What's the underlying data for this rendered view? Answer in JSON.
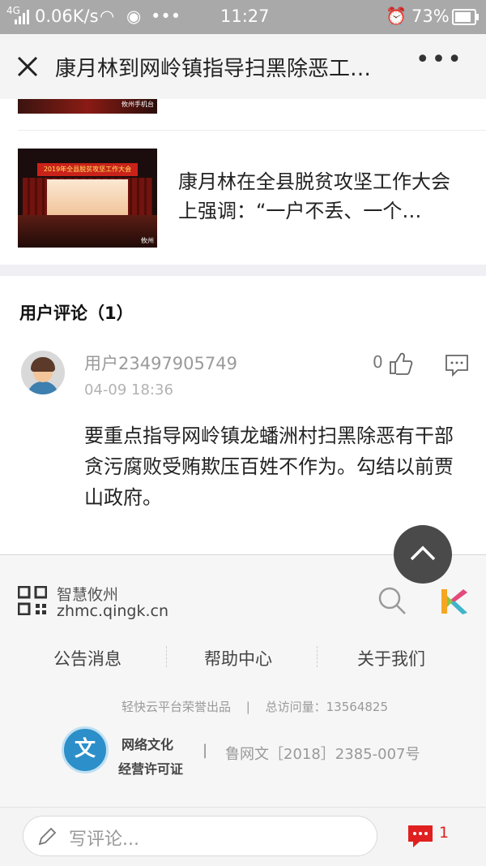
{
  "status": {
    "network": "4G",
    "speed": "0.06K/s",
    "time": "11:27",
    "battery": "73%"
  },
  "header": {
    "title": "康月林到网岭镇指导扫黑除恶工…",
    "more": "•••"
  },
  "related": [
    {
      "image_tag": "攸州手机台"
    },
    {
      "title": "康月林在全县脱贫攻坚工作大会上强调：“一户不丢、一个…",
      "image_banner": "2019年全县脱贫攻坚工作大会",
      "image_tag": "攸州"
    }
  ],
  "comments": {
    "heading": "用户评论（1）",
    "items": [
      {
        "user": "用户23497905749",
        "time": "04-09 18:36",
        "likes": "0",
        "text": "要重点指导网岭镇龙蟠洲村扫黑除恶有干部贪污腐败受贿欺压百姓不作为。勾结以前贾山政府。"
      }
    ]
  },
  "footer": {
    "site_name": "智慧攸州",
    "site_url": "zhmc.qingk.cn",
    "nav": [
      "公告消息",
      "帮助中心",
      "关于我们"
    ],
    "credit": "轻快云平台荣誉出品",
    "visits": "总访问量：13564825",
    "license_line1": "网络文化",
    "license_line2": "经营许可证",
    "license_no": "鲁网文［2018］2385-007号",
    "badge_char": "文"
  },
  "bottom": {
    "placeholder": "写评论...",
    "count": "1"
  },
  "icons": {
    "close": "close-icon",
    "qr": "qr-code-icon",
    "search": "search-icon",
    "edit": "pencil-icon",
    "comment": "comment-bubble-icon",
    "like": "thumbs-up-icon",
    "up": "chevron-up-icon"
  },
  "colors": {
    "accent": "#e02020",
    "status_bar": "#a9a9a9",
    "footer_bg": "#f6f6f6"
  }
}
